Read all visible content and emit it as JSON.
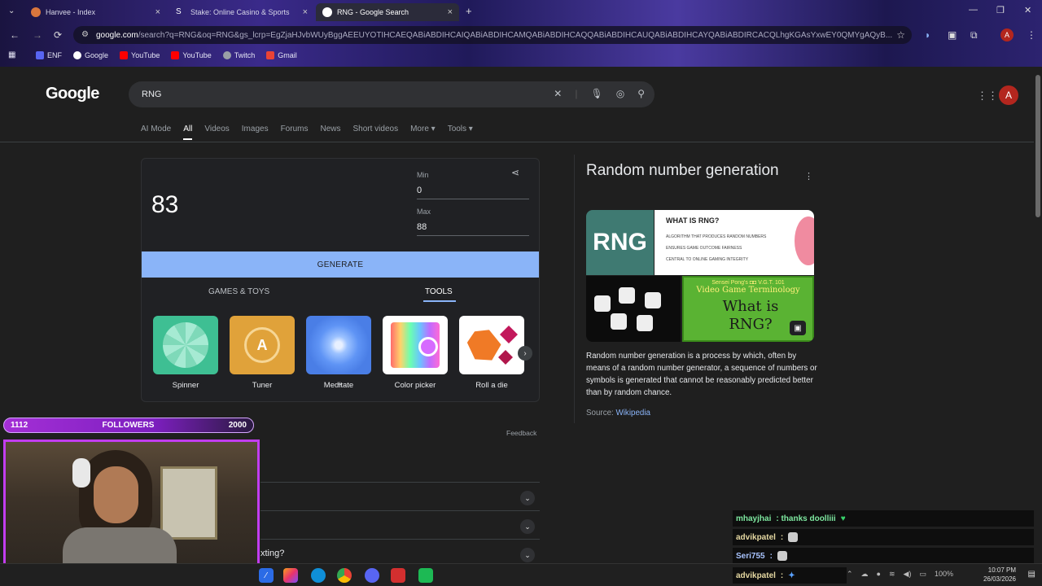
{
  "browser": {
    "tabs": [
      {
        "label": "Hanvee - Index"
      },
      {
        "label": "Stake: Online Casino & Sports"
      },
      {
        "label": "RNG - Google Search"
      }
    ],
    "address": {
      "host": "google.com",
      "rest": "/search?q=RNG&oq=RNG&gs_lcrp=EgZjaHJvbWUyBggAEEUYOTIHCAEQABiABDIHCAIQABiABDIHCAMQABiABDIHCAQQABiABDIHCAUQABiABDIHCAYQABiABDIRCACQLhgKGAsYxwEY0QMYgAQyB..."
    },
    "avatar_letter": "A",
    "bookmarks": [
      {
        "label": "ENF"
      },
      {
        "label": "Google"
      },
      {
        "label": "YouTube"
      },
      {
        "label": "YouTube"
      },
      {
        "label": "Twitch"
      },
      {
        "label": "Gmail"
      }
    ]
  },
  "google": {
    "logo": "Google",
    "query": "RNG",
    "avatar_letter": "A",
    "filters": [
      "AI Mode",
      "All",
      "Videos",
      "Images",
      "Forums",
      "News",
      "Short videos",
      "More ▾",
      "Tools ▾"
    ],
    "active_filter": "All"
  },
  "rng": {
    "result": "83",
    "min_label": "Min",
    "min_value": "0",
    "max_label": "Max",
    "max_value": "88",
    "generate_label": "GENERATE",
    "tab_games": "GAMES & TOYS",
    "tab_tools": "TOOLS",
    "tools": [
      {
        "label": "Spinner"
      },
      {
        "label": "Tuner"
      },
      {
        "label": "Meditate"
      },
      {
        "label": "Color picker"
      },
      {
        "label": "Roll a die"
      }
    ],
    "feedback": "Feedback"
  },
  "knowledge_panel": {
    "title": "Random number generation",
    "image_text": {
      "rng": "RNG",
      "what_is": "WHAT IS RNG?",
      "bullets": [
        "ALGORITHM THAT PRODUCES RANDOM NUMBERS",
        "ENSURES GAME OUTCOME FAIRNESS",
        "CENTRAL TO ONLINE GAMING INTEGRITY"
      ],
      "vgt_header": "Sensei Pong's ◘◘ V.G.T. 101",
      "vgt_sub": "Video Game Terminology",
      "vgt_q": "What is RNG?"
    },
    "description": "Random number generation is a process by which, often by means of a random number generator, a sequence of numbers or symbols is generated that cannot be reasonably predicted better than by random chance.",
    "source_label": "Source:",
    "source_link": "Wikipedia"
  },
  "accordion": [
    {
      "text": ""
    },
    {
      "text": ""
    },
    {
      "text": "xting?"
    }
  ],
  "overlay": {
    "followers_current": "1112",
    "followers_label": "FOLLOWERS",
    "followers_goal": "2000",
    "chat": [
      {
        "user": "mhayjhai",
        "msg": ": thanks doolliii",
        "color": "#7ee8a0"
      },
      {
        "user": "advikpatel",
        "msg": ":",
        "color": "#e6d9a2"
      },
      {
        "user": "Seri755",
        "msg": ":",
        "color": "#a9c4ff"
      },
      {
        "user": "advikpatel",
        "msg": ":",
        "color": "#e6d9a2"
      }
    ]
  },
  "taskbar": {
    "battery": "100%",
    "time": "10:07 PM",
    "date": "26/03/2026"
  },
  "colors": {
    "accent": "#8ab4f8",
    "page_bg": "#1f1f1f",
    "stream_purple": "#c23df0"
  }
}
